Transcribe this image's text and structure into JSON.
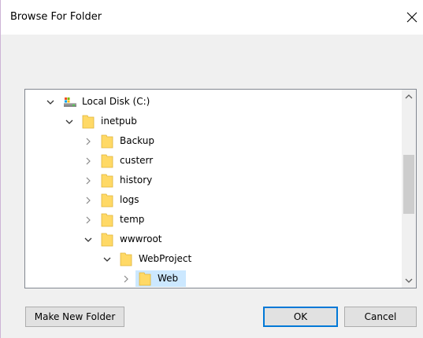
{
  "window": {
    "title": "Browse For Folder",
    "close_glyph": "✕"
  },
  "tree": {
    "items": [
      {
        "label": "Local Disk (C:)",
        "icon": "drive-icon",
        "expanded": true,
        "level": 0
      },
      {
        "label": "inetpub",
        "icon": "folder-icon",
        "expanded": true,
        "level": 1
      },
      {
        "label": "Backup",
        "icon": "folder-icon",
        "expanded": false,
        "level": 2
      },
      {
        "label": "custerr",
        "icon": "folder-icon",
        "expanded": false,
        "level": 2
      },
      {
        "label": "history",
        "icon": "folder-icon",
        "expanded": false,
        "level": 2
      },
      {
        "label": "logs",
        "icon": "folder-icon",
        "expanded": false,
        "level": 2
      },
      {
        "label": "temp",
        "icon": "folder-icon",
        "expanded": false,
        "level": 2
      },
      {
        "label": "wwwroot",
        "icon": "folder-icon",
        "expanded": true,
        "level": 2
      },
      {
        "label": "WebProject",
        "icon": "folder-icon",
        "expanded": true,
        "level": 3
      },
      {
        "label": "Web",
        "icon": "folder-icon",
        "expanded": false,
        "level": 4,
        "selected": true
      }
    ]
  },
  "buttons": {
    "make_new_folder": "Make New Folder",
    "ok": "OK",
    "cancel": "Cancel"
  },
  "colors": {
    "selection": "#cce8ff",
    "folder": "#ffd966",
    "accent": "#0078d7"
  }
}
